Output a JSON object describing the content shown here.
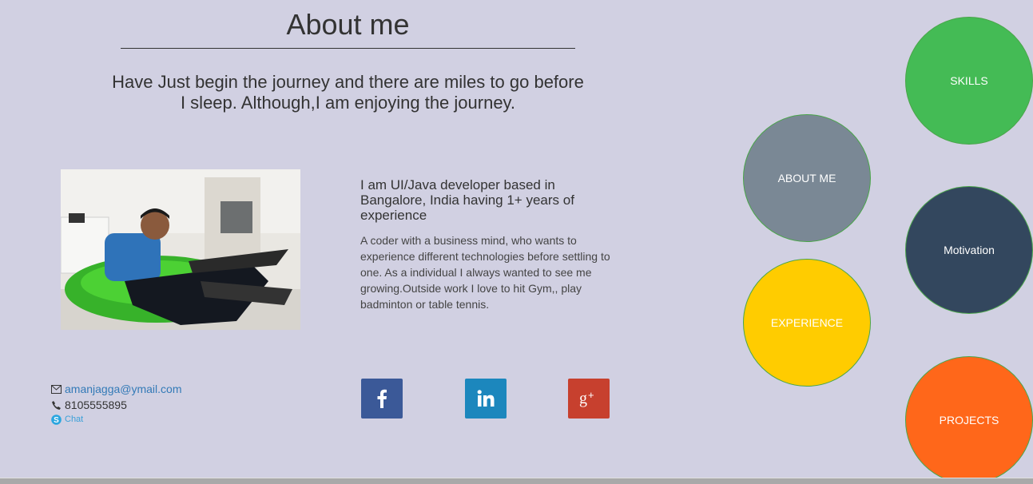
{
  "about": {
    "title": "About me",
    "tagline": "Have Just begin the journey and there are miles to go before I sleep. Although,I am enjoying the journey."
  },
  "bio": {
    "headline": "I am UI/Java developer based in Bangalore, India having 1+ years of experience",
    "text": "A coder with a business mind, who wants to experience different technologies before settling to one. As a individual I always wanted to see me growing.Outside work I love to hit Gym,, play badminton or table tennis."
  },
  "contact": {
    "email": "amanjagga@ymail.com",
    "phone": "8105555895",
    "chat_label": "Chat",
    "email_icon": "envelope-icon",
    "phone_icon": "phone-icon",
    "chat_icon": "skype-icon"
  },
  "social": [
    {
      "name": "facebook",
      "glyph": "f",
      "color": "#3b5998"
    },
    {
      "name": "linkedin",
      "glyph": "in",
      "color": "#1c87bd"
    },
    {
      "name": "google-plus",
      "glyph": "g+",
      "color": "#c7402e"
    }
  ],
  "nav_circles": {
    "skills": {
      "label": "SKILLS",
      "color": "#44bb55"
    },
    "about": {
      "label": "ABOUT ME",
      "color": "#7a8895"
    },
    "motivation": {
      "label": "Motivation",
      "color": "#33475e"
    },
    "experience": {
      "label": "EXPERIENCE",
      "color": "#ffcc00"
    },
    "projects": {
      "label": "PROJECTS",
      "color": "#ff671a"
    }
  }
}
